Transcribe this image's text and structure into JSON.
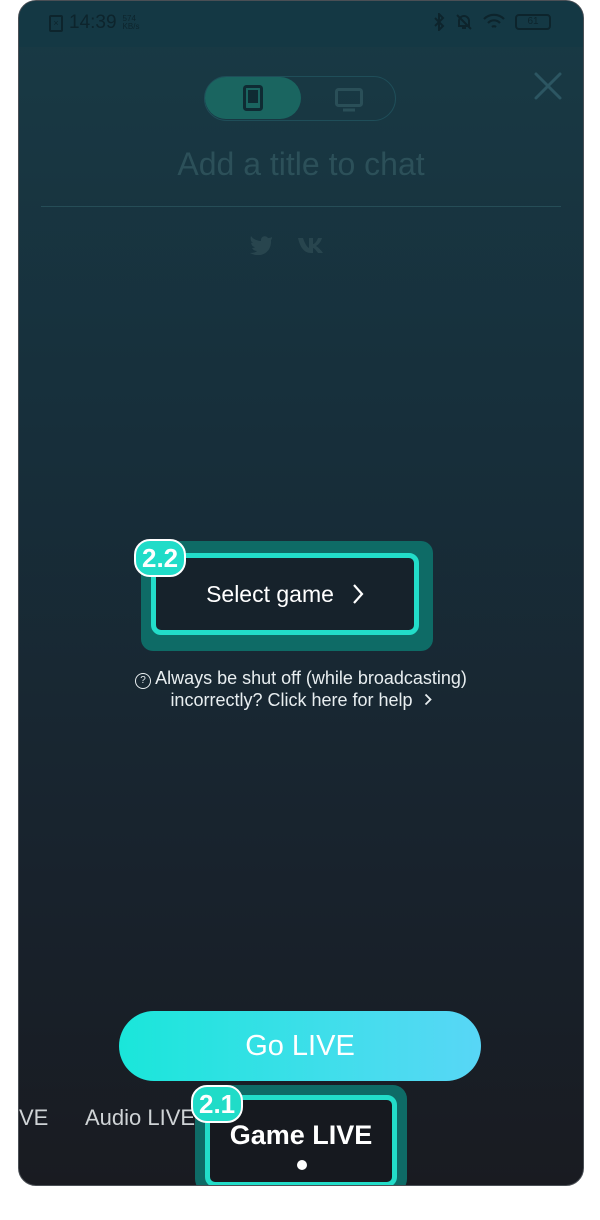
{
  "status_bar": {
    "time": "14:39",
    "speed_value": "574",
    "speed_unit": "KB/s",
    "battery": "61"
  },
  "header": {
    "mode_toggle": {
      "phone_icon": "phone-icon",
      "pc_icon": "monitor-icon"
    },
    "close_icon": "close-icon"
  },
  "title_input": {
    "placeholder": "Add a title to chat"
  },
  "share_icons": [
    "twitter-icon",
    "vk-icon"
  ],
  "select_game": {
    "label": "Select game",
    "badge": "2.2"
  },
  "help": {
    "line1": "Always be shut off (while broadcasting)",
    "line2": "incorrectly? Click here for help"
  },
  "go_live": {
    "label": "Go LIVE"
  },
  "modes": {
    "partial": "VE",
    "audio": "Audio LIVE",
    "game": "Game LIVE",
    "game_badge": "2.1"
  },
  "colors": {
    "accent": "#22ddc9",
    "highlight_bg": "#0e6b66",
    "background_top": "#183a45",
    "background_bottom": "#191b21"
  }
}
